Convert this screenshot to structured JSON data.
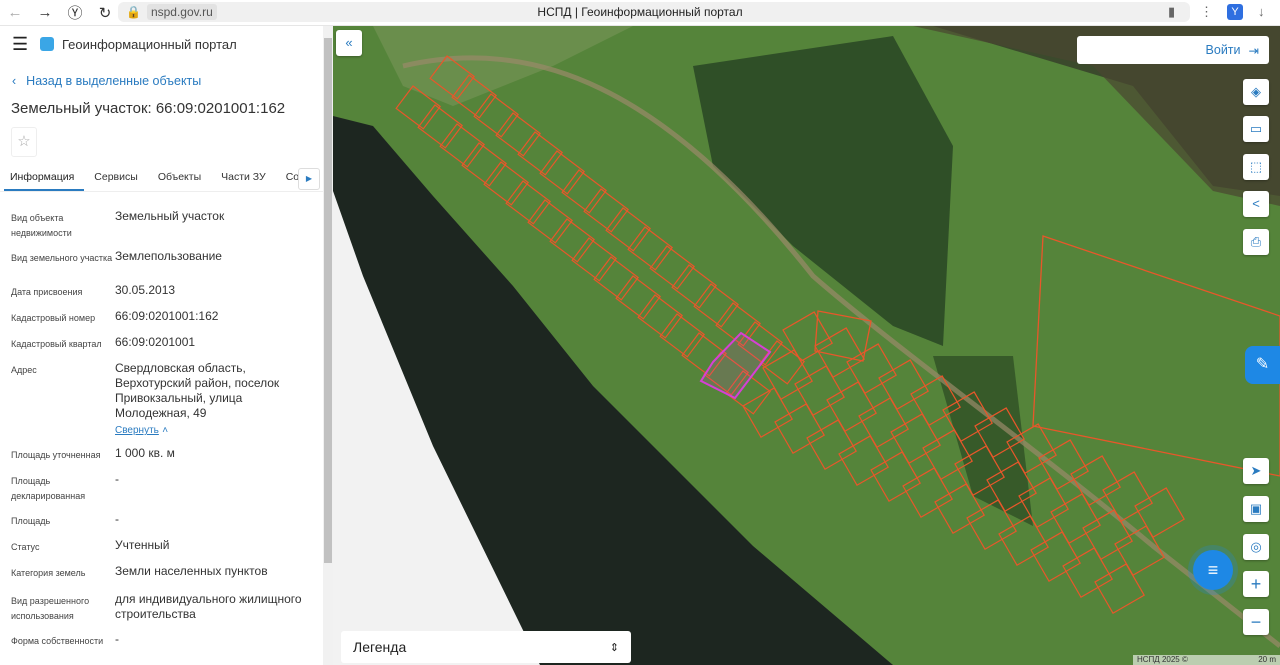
{
  "browser": {
    "url": "nspd.gov.ru",
    "title": "НСПД | Геоинформационный портал"
  },
  "header": {
    "brand": "Геоинформационный портал"
  },
  "panel": {
    "back_label": "Назад в выделенные объекты",
    "title": "Земельный участок: 66:09:0201001:162",
    "tabs": [
      {
        "label": "Информация"
      },
      {
        "label": "Сервисы"
      },
      {
        "label": "Объекты"
      },
      {
        "label": "Части ЗУ"
      },
      {
        "label": "Соста"
      }
    ],
    "fields": [
      {
        "label": "Вид объекта недвижимости",
        "value": "Земельный участок"
      },
      {
        "label": "Вид земельного участка",
        "value": "Землепользование"
      },
      {
        "label": "Дата присвоения",
        "value": "30.05.2013"
      },
      {
        "label": "Кадастровый номер",
        "value": "66:09:0201001:162"
      },
      {
        "label": "Кадастровый квартал",
        "value": "66:09:0201001"
      },
      {
        "label": "Адрес",
        "value": "Свердловская область, Верхотурский район, поселок Привокзальный, улица Молодежная, 49"
      },
      {
        "label": "Площадь уточненная",
        "value": "1 000 кв. м"
      },
      {
        "label": "Площадь декларированная",
        "value": "-"
      },
      {
        "label": "Площадь",
        "value": "-"
      },
      {
        "label": "Статус",
        "value": "Учтенный"
      },
      {
        "label": "Категория земель",
        "value": "Земли населенных пунктов"
      },
      {
        "label": "Вид разрешенного использования",
        "value": "для индивидуального жилищного строительства"
      },
      {
        "label": "Форма собственности",
        "value": "-"
      }
    ],
    "collapse_label": "Свернуть"
  },
  "map": {
    "login_label": "Войти",
    "legend_label": "Легенда",
    "attribution": "НСПД 2025 ©",
    "scale": "20 m",
    "parcel_color": "#e8572a",
    "selected_color": "#d63fd6"
  }
}
